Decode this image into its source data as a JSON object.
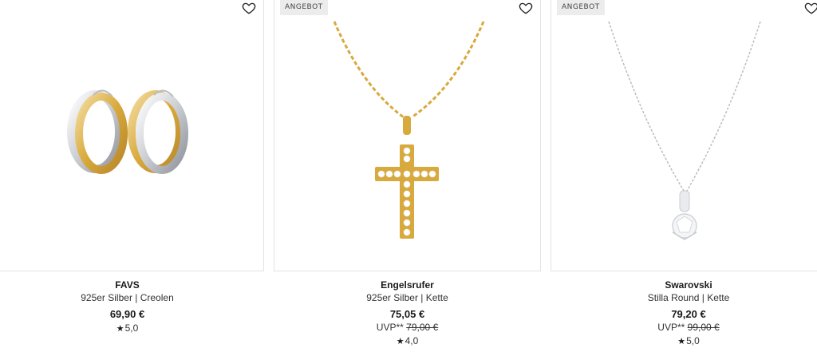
{
  "products": [
    {
      "brand": "FAVS",
      "description": "925er Silber | Creolen",
      "price": "69,90 €",
      "rating": "5,0",
      "rating_icon": "star-icon"
    },
    {
      "badge": "ANGEBOT",
      "brand": "Engelsrufer",
      "description": "925er Silber | Kette",
      "price": "75,05 €",
      "uvp_label": "UVP**",
      "uvp_price": "79,00 €",
      "rating": "4,0",
      "rating_icon": "star-icon"
    },
    {
      "badge": "ANGEBOT",
      "brand": "Swarovski",
      "description": "Stilla Round | Kette",
      "price": "79,20 €",
      "uvp_label": "UVP**",
      "uvp_price": "99,00 €",
      "rating": "5,0",
      "rating_icon": "star-icon"
    }
  ],
  "colors": {
    "gold": "#d8a93c",
    "silver": "#c9ccd1",
    "border": "#e3e3e3",
    "badge_bg": "#ececec"
  }
}
